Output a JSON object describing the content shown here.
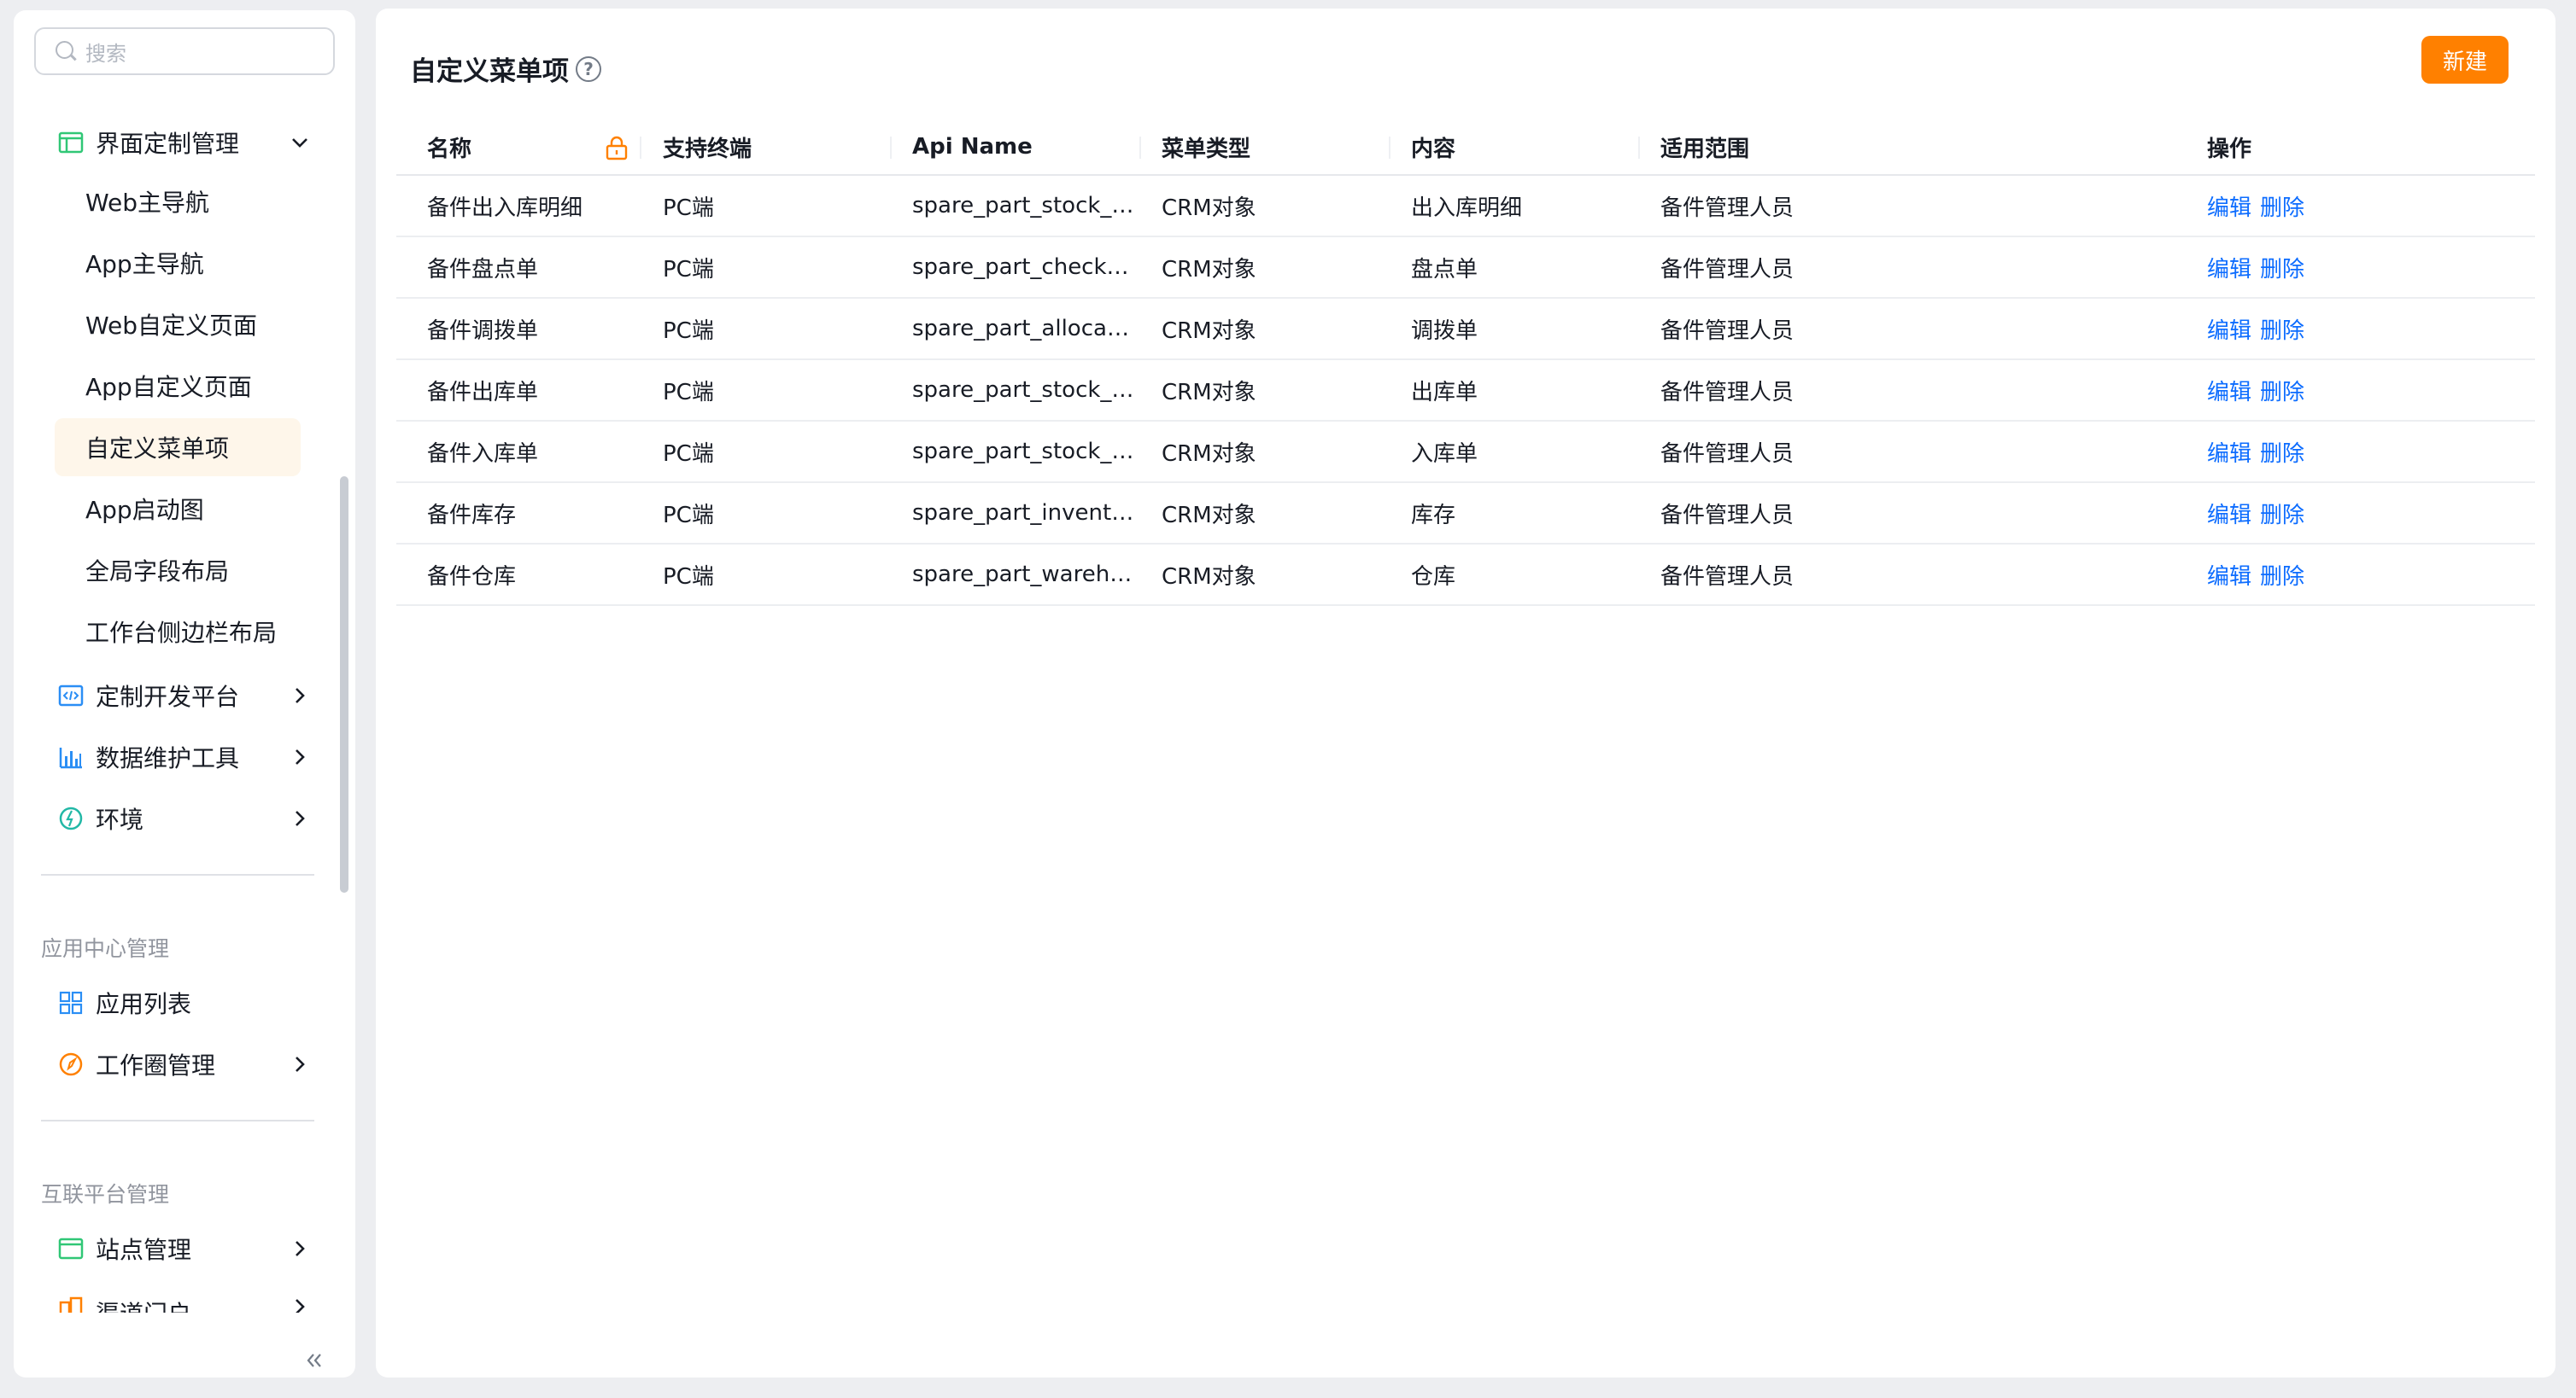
{
  "sidebar": {
    "search_placeholder": "搜索",
    "menu": {
      "ui_custom": "界面定制管理",
      "sub_items": [
        "Web主导航",
        "App主导航",
        "Web自定义页面",
        "App自定义页面",
        "自定义菜单项",
        "App启动图",
        "全局字段布局",
        "工作台侧边栏布局"
      ],
      "dev_platform": "定制开发平台",
      "data_tools": "数据维护工具",
      "environment": "环境"
    },
    "app_center": {
      "title": "应用中心管理",
      "app_list": "应用列表",
      "work_circle": "工作圈管理"
    },
    "interconnect": {
      "title": "互联平台管理",
      "site_mgmt": "站点管理",
      "channel_portal": "渠道门户"
    },
    "icons": [
      "layout-icon",
      "code-icon",
      "bar-chart-icon",
      "environment-icon",
      "grid-icon",
      "compass-icon",
      "site-icon",
      "portal-icon",
      "chevron-down-icon",
      "chevron-right-icon",
      "double-chevron-left-icon"
    ]
  },
  "main": {
    "title": "自定义菜单项",
    "new_button": "新建",
    "columns": [
      "名称",
      "支持终端",
      "Api Name",
      "菜单类型",
      "内容",
      "适用范围",
      "操作"
    ],
    "rows": [
      {
        "name": "备件出入库明细",
        "terminal": "PC端",
        "api": "spare_part_stock_d...",
        "type": "CRM对象",
        "content": "出入库明细",
        "scope": "备件管理人员",
        "edit": "编辑",
        "delete": "删除"
      },
      {
        "name": "备件盘点单",
        "terminal": "PC端",
        "api": "spare_part_check__c",
        "type": "CRM对象",
        "content": "盘点单",
        "scope": "备件管理人员",
        "edit": "编辑",
        "delete": "删除"
      },
      {
        "name": "备件调拨单",
        "terminal": "PC端",
        "api": "spare_part_allocati...",
        "type": "CRM对象",
        "content": "调拨单",
        "scope": "备件管理人员",
        "edit": "编辑",
        "delete": "删除"
      },
      {
        "name": "备件出库单",
        "terminal": "PC端",
        "api": "spare_part_stock_o...",
        "type": "CRM对象",
        "content": "出库单",
        "scope": "备件管理人员",
        "edit": "编辑",
        "delete": "删除"
      },
      {
        "name": "备件入库单",
        "terminal": "PC端",
        "api": "spare_part_stock_i...",
        "type": "CRM对象",
        "content": "入库单",
        "scope": "备件管理人员",
        "edit": "编辑",
        "delete": "删除"
      },
      {
        "name": "备件库存",
        "terminal": "PC端",
        "api": "spare_part_invento...",
        "type": "CRM对象",
        "content": "库存",
        "scope": "备件管理人员",
        "edit": "编辑",
        "delete": "删除"
      },
      {
        "name": "备件仓库",
        "terminal": "PC端",
        "api": "spare_part_wareho...",
        "type": "CRM对象",
        "content": "仓库",
        "scope": "备件管理人员",
        "edit": "编辑",
        "delete": "删除"
      }
    ]
  },
  "colors": {
    "accent": "#ff8000",
    "link": "#0c6cff",
    "active_bg": "#fef6ea"
  }
}
